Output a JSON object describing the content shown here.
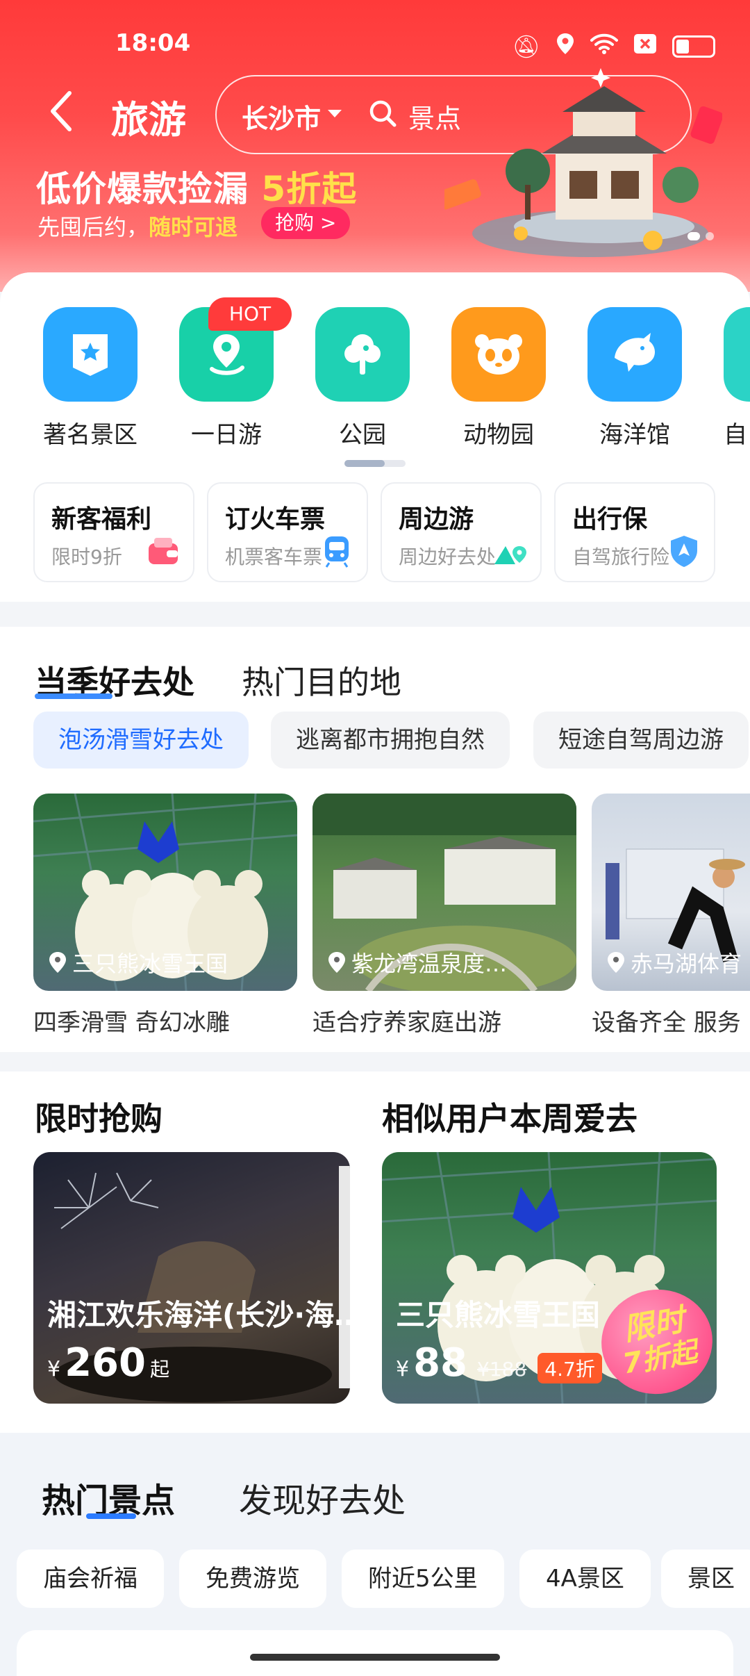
{
  "status_bar": {
    "time": "18:04"
  },
  "header": {
    "title": "旅游",
    "city": "长沙市",
    "search_placeholder": "景点",
    "promo_main": "低价爆款捡漏 ",
    "promo_highlight": "5折起",
    "promo_sub": "先囤后约，",
    "promo_sub_highlight": "随时可退",
    "promo_button": "抢购 >"
  },
  "categories": [
    {
      "label": "著名景区",
      "icon": "scenic-badge-icon",
      "color": "#2aa9ff"
    },
    {
      "label": "一日游",
      "icon": "route-pin-icon",
      "color": "#18d0a8",
      "badge": "HOT"
    },
    {
      "label": "公园",
      "icon": "tree-icon",
      "color": "#1fd1b4"
    },
    {
      "label": "动物园",
      "icon": "panda-icon",
      "color": "#ff9a1c"
    },
    {
      "label": "海洋馆",
      "icon": "dolphin-icon",
      "color": "#29a8ff"
    },
    {
      "label": "自",
      "icon": "partial-icon",
      "color": "#2bd3c6"
    }
  ],
  "quick_entries": [
    {
      "title": "新客福利",
      "desc": "限时9折"
    },
    {
      "title": "订火车票",
      "desc": "机票客车票"
    },
    {
      "title": "周边游",
      "desc": "周边好去处"
    },
    {
      "title": "出行保",
      "desc": "自驾旅行险"
    }
  ],
  "season": {
    "tabs": [
      "当季好去处",
      "热门目的地"
    ],
    "chips": [
      "泡汤滑雪好去处",
      "逃离都市拥抱自然",
      "短途自驾周边游"
    ],
    "cards": [
      {
        "location": "三只熊冰雪王国",
        "desc": "四季滑雪 奇幻冰雕"
      },
      {
        "location": "紫龙湾温泉度…",
        "desc": "适合疗养家庭出游"
      },
      {
        "location": "赤马湖体育",
        "desc": "设备齐全 服务"
      }
    ]
  },
  "flash": {
    "title": "限时抢购",
    "name": "湘江欢乐海洋(长沙·海…",
    "currency": "¥",
    "price": "260",
    "suffix": "起"
  },
  "similar": {
    "title": "相似用户本周爱去",
    "name": "三只熊冰雪王国",
    "currency": "¥",
    "price": "88",
    "original": "¥188",
    "discount": "4.7折",
    "stamp_line1": "限时",
    "stamp_line2": "7折起"
  },
  "hot_spots": {
    "tabs": [
      "热门景点",
      "发现好去处"
    ],
    "chips": [
      "庙会祈福",
      "免费游览",
      "附近5公里",
      "4A景区",
      "景区"
    ]
  }
}
